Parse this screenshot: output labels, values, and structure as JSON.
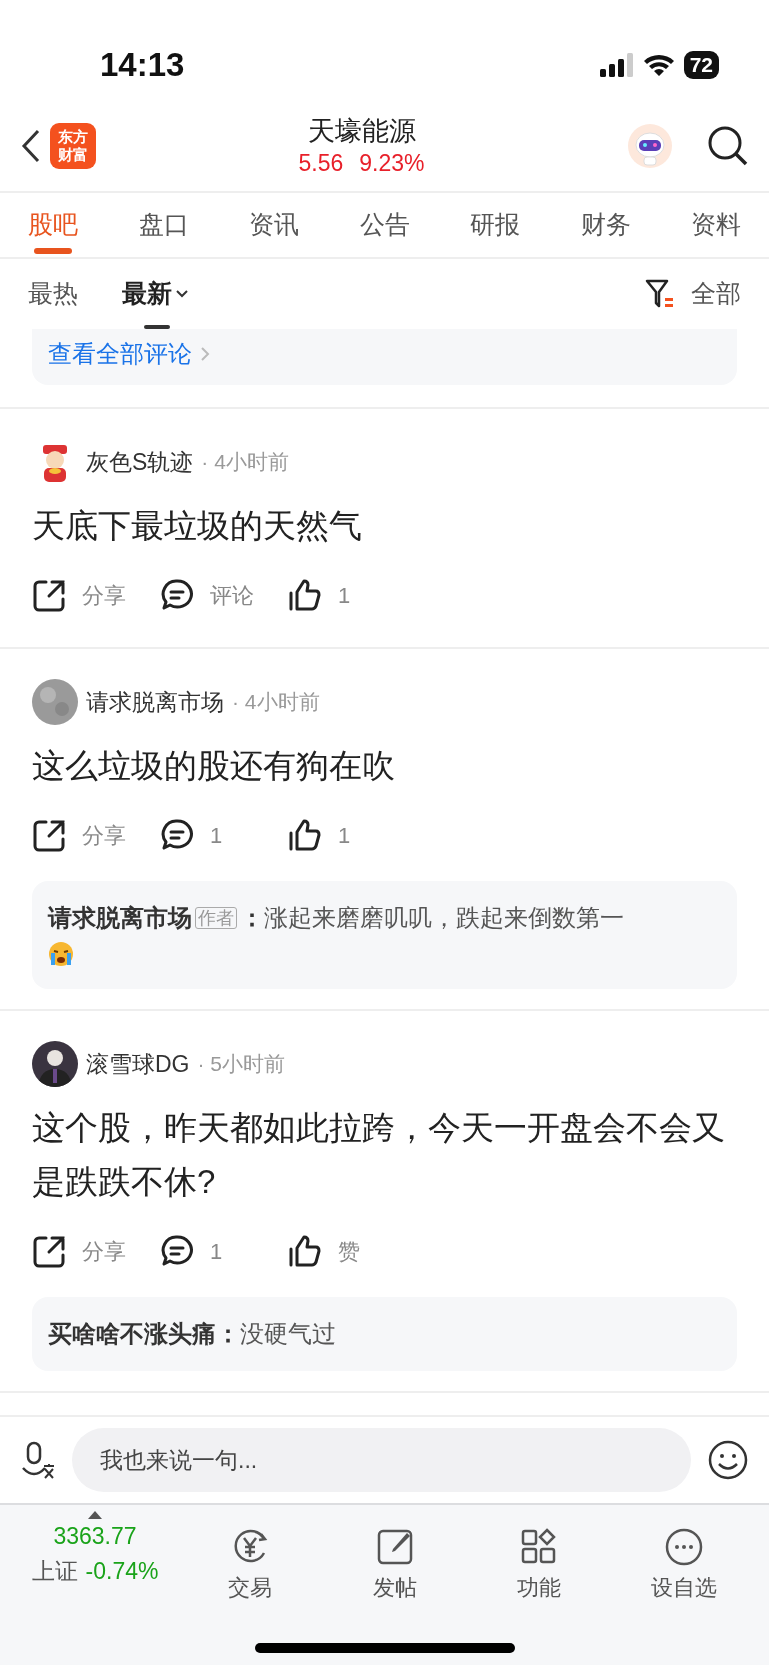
{
  "status_bar": {
    "time": "14:13",
    "battery": "72"
  },
  "header": {
    "title": "天壕能源",
    "price": "5.56",
    "change": "9.23%",
    "logo_lines": [
      "东方",
      "财富"
    ]
  },
  "tabs": [
    {
      "label": "股吧",
      "selected": true
    },
    {
      "label": "盘口",
      "selected": false
    },
    {
      "label": "资讯",
      "selected": false
    },
    {
      "label": "公告",
      "selected": false
    },
    {
      "label": "研报",
      "selected": false
    },
    {
      "label": "财务",
      "selected": false
    },
    {
      "label": "资料",
      "selected": false
    }
  ],
  "sort": {
    "options": [
      {
        "label": "最热",
        "selected": false
      },
      {
        "label": "最新",
        "selected": true
      }
    ],
    "filter_label": "全部"
  },
  "comments_link": "查看全部评论",
  "posts": [
    {
      "author": "灰色S轨迹",
      "time": "· 4小时前",
      "text": "天底下最垃圾的天然气",
      "share": "分享",
      "comment": "评论",
      "like": "1"
    },
    {
      "author": "请求脱离市场",
      "time": "· 4小时前",
      "text": "这么垃圾的股还有狗在吹",
      "share": "分享",
      "comment": "1",
      "like": "1",
      "replies": [
        {
          "kind": "emoji_end",
          "author": "请求脱离市场",
          "tag": "作者",
          "separator": "：",
          "text": "涨起来磨磨叽叽，跌起来倒数第一"
        }
      ]
    },
    {
      "author": "滚雪球DG",
      "time": "· 5小时前",
      "text": "这个股，昨天都如此拉跨，今天一开盘会不会又是跌跌不休?",
      "share": "分享",
      "comment": "1",
      "like": "赞",
      "replies": [
        {
          "kind": "plain",
          "author": "买啥啥不涨头痛",
          "separator": "：",
          "text": "没硬气过"
        }
      ]
    }
  ],
  "composer": {
    "placeholder": "我也来说一句..."
  },
  "bottom_bar": {
    "index_value": "3363.77",
    "index_name": "上证",
    "index_change": "-0.74%",
    "items": [
      {
        "kind": "trade",
        "label": "交易"
      },
      {
        "kind": "post",
        "label": "发帖"
      },
      {
        "kind": "apps",
        "label": "功能"
      },
      {
        "kind": "more",
        "label": "设自选"
      }
    ]
  }
}
